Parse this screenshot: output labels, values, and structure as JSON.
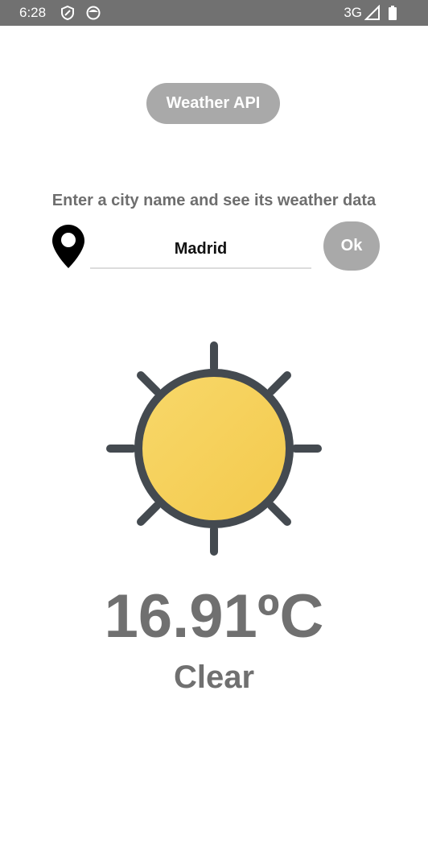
{
  "status_bar": {
    "time": "6:28",
    "network": "3G",
    "icons": [
      "shield-icon",
      "face-icon",
      "signal-icon",
      "battery-icon"
    ]
  },
  "header": {
    "title": "Weather API"
  },
  "search": {
    "instruction": "Enter a city name and see its weather data",
    "city_value": "Madrid",
    "ok_label": "Ok",
    "location_icon": "map-pin-icon"
  },
  "weather": {
    "icon": "sun-icon",
    "temperature": "16.91ºC",
    "condition": "Clear"
  },
  "colors": {
    "status_bar": "#717171",
    "button_bg": "#a9a9a9",
    "text_gray": "#707070",
    "sun_fill": "#f5cf57",
    "sun_stroke": "#444a50"
  }
}
